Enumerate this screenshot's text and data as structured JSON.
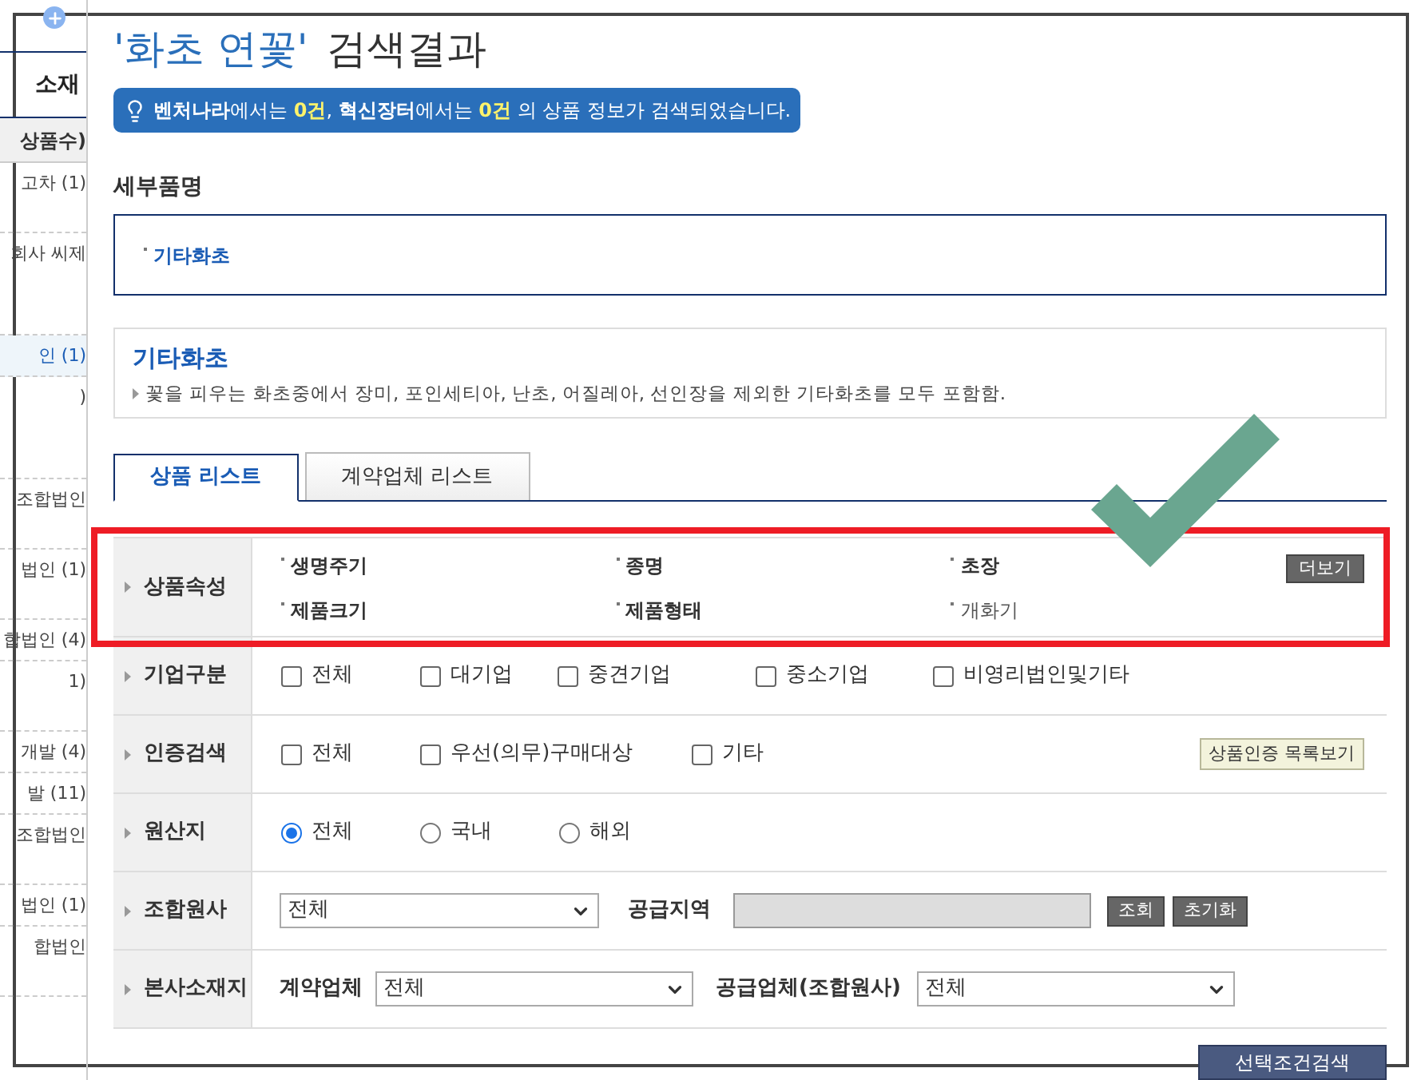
{
  "sidebar": {
    "heading": "소재",
    "column_header": "상품수)",
    "items": [
      {
        "text": "고차 (1)",
        "kind": "double",
        "selected": false
      },
      {
        "text": "회사 씨제",
        "kind": "triple",
        "selected": false
      },
      {
        "text": "인 (1)",
        "kind": "single",
        "selected": true
      },
      {
        "text": ")",
        "kind": "triple",
        "selected": false
      },
      {
        "text": "조합법인",
        "kind": "double",
        "selected": false
      },
      {
        "text": "법인 (1)",
        "kind": "double",
        "selected": false
      },
      {
        "text": "합법인 (4)",
        "kind": "single",
        "selected": false
      },
      {
        "text": "1)",
        "kind": "double",
        "selected": false
      },
      {
        "text": "개발 (4)",
        "kind": "single",
        "selected": false
      },
      {
        "text": "발 (11)",
        "kind": "single",
        "selected": false
      },
      {
        "text": "조합법인",
        "kind": "double",
        "selected": false
      },
      {
        "text": "법인 (1)",
        "kind": "single",
        "selected": false
      },
      {
        "text": "합법인",
        "kind": "double",
        "selected": false
      }
    ]
  },
  "title": {
    "query": "'화초 연꽃'",
    "suffix": "검색결과"
  },
  "notice": [
    {
      "kind": "bold",
      "text": "벤처나라"
    },
    {
      "kind": "plain",
      "text": "에서는 "
    },
    {
      "kind": "count",
      "text": "0건"
    },
    {
      "kind": "plain",
      "text": ", "
    },
    {
      "kind": "bold",
      "text": "혁신장터"
    },
    {
      "kind": "plain",
      "text": "에서는 "
    },
    {
      "kind": "count",
      "text": "0건"
    },
    {
      "kind": "plain",
      "text": " 의 상품 정보가 검색되었습니다."
    }
  ],
  "detail_section": {
    "heading": "세부품명",
    "items": [
      "기타화초"
    ]
  },
  "category": {
    "name": "기타화초",
    "description": "꽃을 피우는 화초중에서 장미, 포인세티아, 난초, 어질레아, 선인장을 제외한 기타화초를 모두 포함함."
  },
  "tabs": [
    {
      "label": "상품 리스트",
      "selected": true
    },
    {
      "label": "계약업체 리스트",
      "selected": false
    }
  ],
  "filters": {
    "attributes": {
      "label": "상품속성",
      "highlighted": true,
      "items": [
        {
          "text": "생명주기",
          "emphasized": true
        },
        {
          "text": "종명",
          "emphasized": true
        },
        {
          "text": "초장",
          "emphasized": true
        },
        {
          "text": "제품크기",
          "emphasized": true
        },
        {
          "text": "제품형태",
          "emphasized": true
        },
        {
          "text": "개화기",
          "emphasized": false
        }
      ],
      "more_button": "더보기"
    },
    "company_type": {
      "label": "기업구분",
      "options": [
        {
          "label": "전체",
          "checked": false
        },
        {
          "label": "대기업",
          "checked": false
        },
        {
          "label": "중견기업",
          "checked": false
        },
        {
          "label": "중소기업",
          "checked": false
        },
        {
          "label": "비영리법인및기타",
          "checked": false
        }
      ]
    },
    "certification": {
      "label": "인증검색",
      "options": [
        {
          "label": "전체",
          "checked": false
        },
        {
          "label": "우선(의무)구매대상",
          "checked": false
        },
        {
          "label": "기타",
          "checked": false
        }
      ],
      "button": "상품인증 목록보기"
    },
    "origin": {
      "label": "원산지",
      "options": [
        {
          "label": "전체",
          "selected": true
        },
        {
          "label": "국내",
          "selected": false
        },
        {
          "label": "해외",
          "selected": false
        }
      ]
    },
    "member": {
      "label": "조합원사",
      "select": "전체",
      "region_label": "공급지역",
      "buttons": [
        "조회",
        "초기화"
      ]
    },
    "headquarters": {
      "label": "본사소재지",
      "contract_label": "계약업체",
      "contract_select": "전체",
      "supplier_label": "공급업체(조합원사)",
      "supplier_select": "전체"
    }
  },
  "search_button": "선택조건검색"
}
